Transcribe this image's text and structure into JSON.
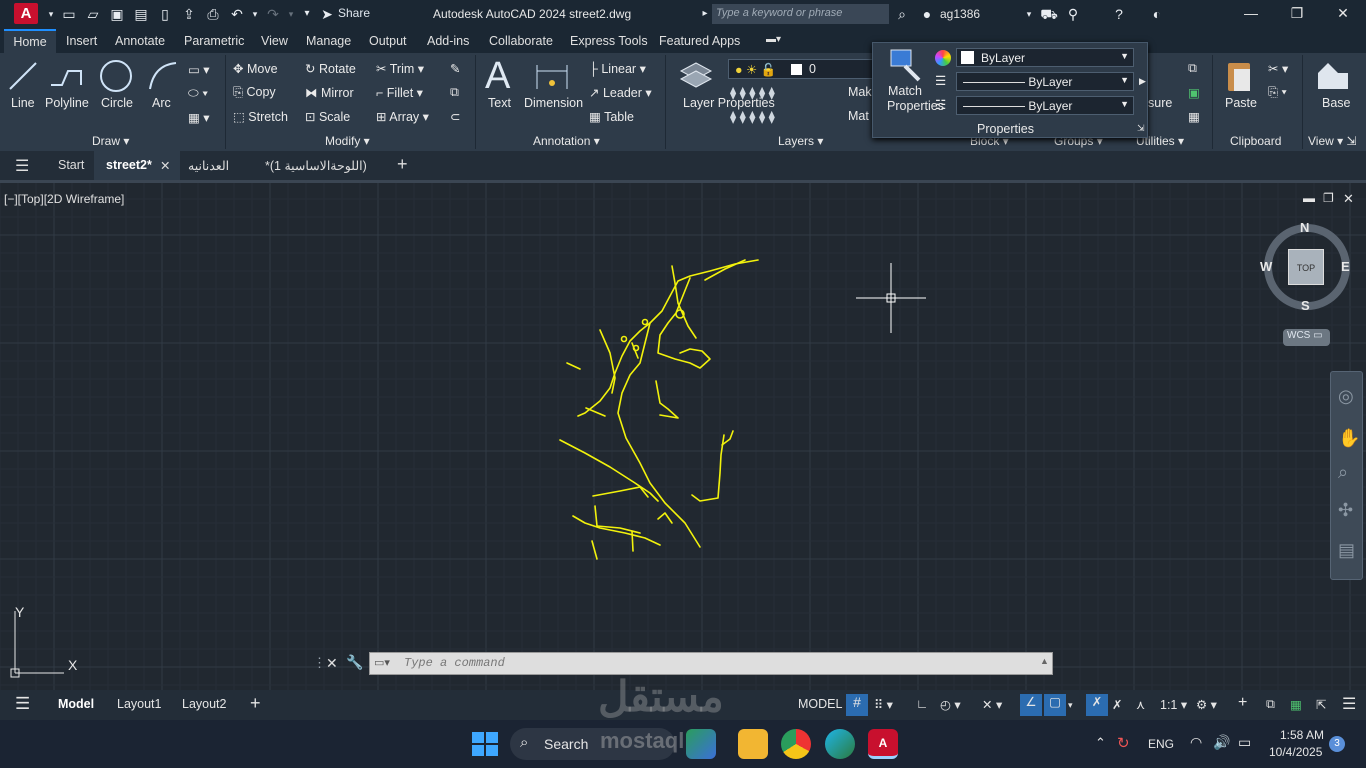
{
  "titlebar": {
    "app_letter": "A",
    "share_label": "Share",
    "title": "Autodesk AutoCAD 2024    street2.dwg",
    "search_placeholder": "Type a keyword or phrase",
    "username": "ag1386"
  },
  "ribbon_tabs": [
    "Home",
    "Insert",
    "Annotate",
    "Parametric",
    "View",
    "Manage",
    "Output",
    "Add-ins",
    "Collaborate",
    "Express Tools",
    "Featured Apps"
  ],
  "draw": {
    "label": "Draw",
    "line": "Line",
    "polyline": "Polyline",
    "circle": "Circle",
    "arc": "Arc"
  },
  "modify": {
    "label": "Modify",
    "move": "Move",
    "copy": "Copy",
    "stretch": "Stretch",
    "rotate": "Rotate",
    "mirror": "Mirror",
    "scale": "Scale",
    "trim": "Trim",
    "fillet": "Fillet",
    "array": "Array"
  },
  "annotation": {
    "label": "Annotation",
    "text": "Text",
    "dimension": "Dimension",
    "linear": "Linear",
    "leader": "Leader",
    "table": "Table"
  },
  "layers": {
    "label": "Layers",
    "layer_properties": "Layer Properties",
    "current_layer": "0",
    "make": "Mak",
    "match": "Mat"
  },
  "properties": {
    "label": "Properties",
    "match_properties": "Match Properties",
    "color": "ByLayer",
    "linetype": "ByLayer",
    "lineweight": "ByLayer"
  },
  "other_panels": {
    "block": "Block",
    "groups": "Groups",
    "utilities": "Utilities",
    "measure": "sure",
    "clipboard": "Clipboard",
    "paste": "Paste",
    "view": "View",
    "base": "Base"
  },
  "file_tabs": [
    "Start",
    "street2*",
    "العدنانيه",
    "(اللوحةالاساسية 1)*"
  ],
  "viewport": {
    "label": "[−][Top][2D Wireframe]",
    "compass": {
      "n": "N",
      "s": "S",
      "e": "E",
      "w": "W",
      "top": "TOP"
    },
    "wcs": "WCS",
    "ucs_x": "X",
    "ucs_y": "Y"
  },
  "command": {
    "placeholder": "Type a command"
  },
  "layout_tabs": [
    "Model",
    "Layout1",
    "Layout2"
  ],
  "status": {
    "model": "MODEL",
    "scale": "1:1"
  },
  "taskbar": {
    "search": "Search",
    "lang": "ENG",
    "time": "1:58 AM",
    "date": "10/4/2025",
    "badge": "3"
  },
  "watermark": {
    "text": "mostaql",
    "arabic": "مستقل"
  },
  "colors": {
    "drawing": "#f2f20c",
    "accent": "#1f8fff",
    "appred": "#c8102e"
  }
}
